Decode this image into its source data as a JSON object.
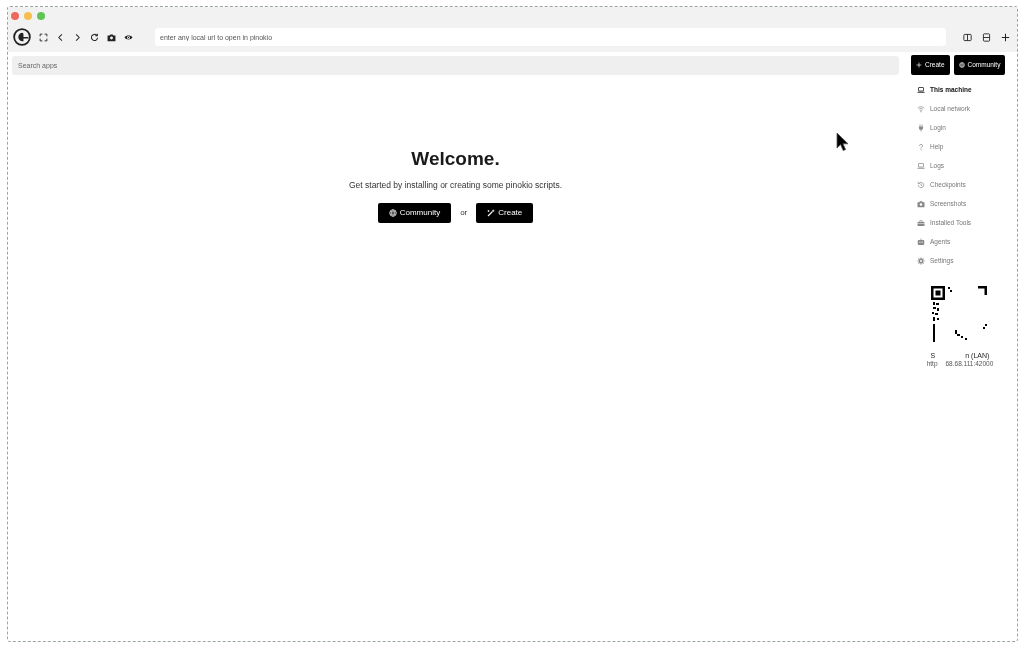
{
  "toolbar": {
    "url_field": {
      "placeholder": "enter any local url to open in pinokio"
    }
  },
  "search": {
    "placeholder": "Search apps"
  },
  "header_buttons": [
    {
      "kind": "create",
      "label": "Create"
    },
    {
      "kind": "community",
      "label": "Community"
    }
  ],
  "sidebar": {
    "items": [
      {
        "label": "This machine",
        "selected": true
      },
      {
        "label": "Local network",
        "selected": false
      },
      {
        "label": "Login",
        "selected": false
      },
      {
        "label": "Help",
        "selected": false
      },
      {
        "label": "Logs",
        "selected": false
      },
      {
        "label": "Checkpoints",
        "selected": false
      },
      {
        "label": "Screenshots",
        "selected": false
      },
      {
        "label": "Installed Tools",
        "selected": false
      },
      {
        "label": "Agents",
        "selected": false
      },
      {
        "label": "Settings",
        "selected": false
      }
    ]
  },
  "welcome": {
    "title": "Welcome.",
    "subtitle": "Get started by installing or creating some pinokio scripts.",
    "buttons": [
      {
        "kind": "community",
        "label": "Community"
      },
      {
        "kind": "create",
        "label": "Create"
      }
    ],
    "separator": "or"
  },
  "share_panel": {
    "caption_parts": [
      "S",
      "n (LAN)"
    ],
    "address_parts": [
      "http",
      "68.68.111:42000"
    ]
  }
}
